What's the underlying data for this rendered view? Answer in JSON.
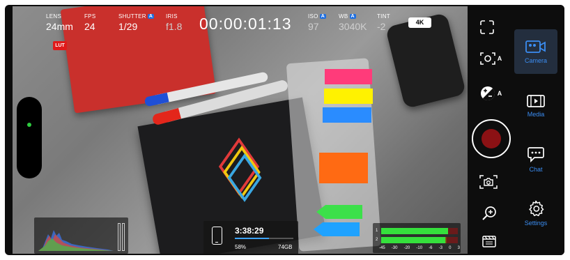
{
  "hud": {
    "lens": {
      "label": "LENS",
      "value": "24mm"
    },
    "fps": {
      "label": "FPS",
      "value": "24"
    },
    "shutter": {
      "label": "SHUTTER",
      "auto": "A",
      "value": "1/29"
    },
    "iris": {
      "label": "IRIS",
      "value": "f1.8"
    },
    "timecode": "00:00:01:13",
    "iso": {
      "label": "ISO",
      "auto": "A",
      "value": "97"
    },
    "wb": {
      "label": "WB",
      "auto": "A",
      "value": "3040K"
    },
    "tint": {
      "label": "TINT",
      "value": "-2"
    },
    "resolution": "4K",
    "lut": "LUT"
  },
  "storage": {
    "remaining_time": "3:38:29",
    "percent_label": "58%",
    "percent_value": 0.58,
    "capacity": "74GB"
  },
  "audio_meters": {
    "channels": [
      "1",
      "2"
    ],
    "levels_db": [
      -3,
      -5
    ],
    "scale": [
      "-45",
      "-30",
      "-20",
      "-10",
      "-6",
      "-3",
      "0",
      "3"
    ]
  },
  "controls": {
    "focus_auto": "A",
    "exposure_auto": "A",
    "icons": [
      "fullscreen-icon",
      "autofocus-icon",
      "exposure-icon",
      "record-button",
      "stabilization-icon",
      "zoom-in-icon",
      "clapperboard-icon"
    ]
  },
  "nav": {
    "items": [
      {
        "label": "Camera",
        "icon": "camera-icon",
        "active": true
      },
      {
        "label": "Media",
        "icon": "film-icon",
        "active": false
      },
      {
        "label": "Chat",
        "icon": "chat-icon",
        "active": false
      },
      {
        "label": "Settings",
        "icon": "gear-icon",
        "active": false
      }
    ]
  },
  "colors": {
    "accent": "#3b8df2",
    "record": "#8b1114",
    "auto_badge": "#1f6fe0",
    "lut_badge": "#e01a1a"
  }
}
